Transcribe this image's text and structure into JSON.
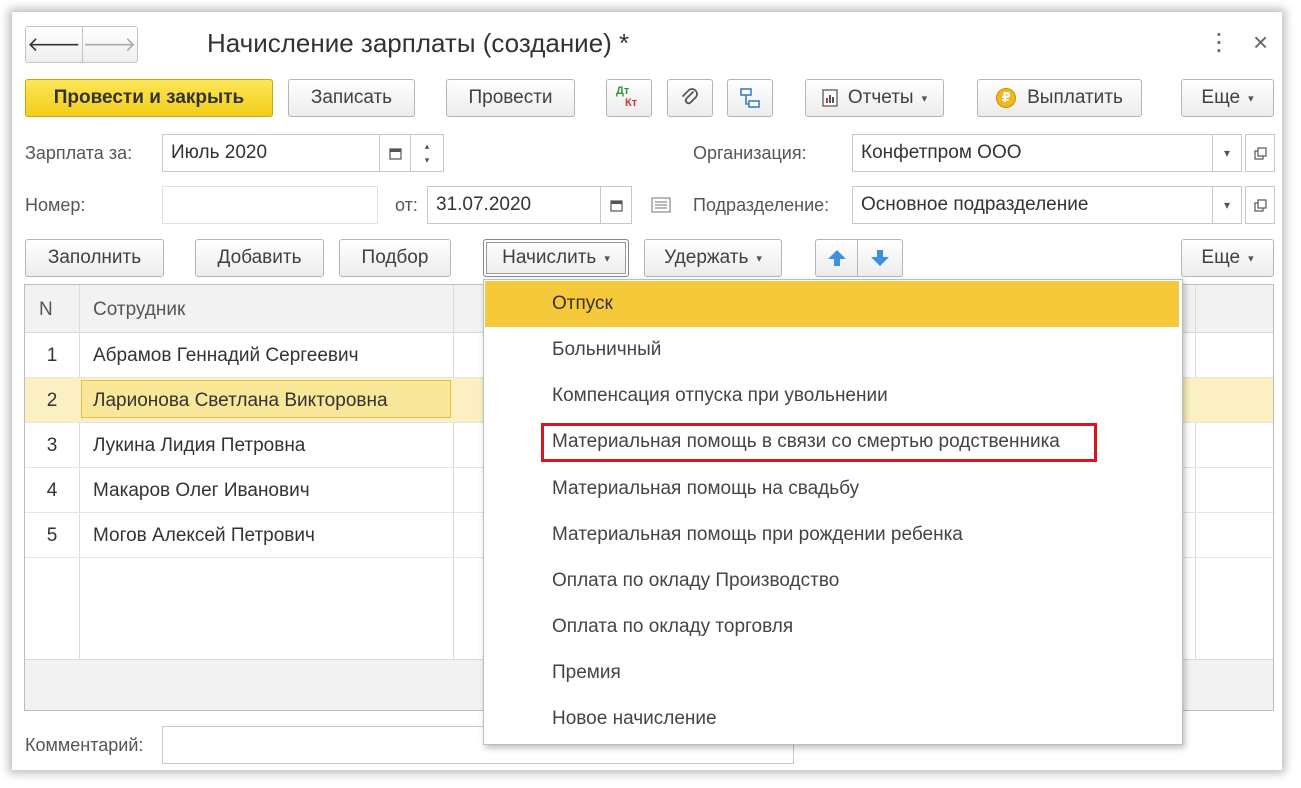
{
  "window": {
    "title": "Начисление зарплаты (создание) *",
    "more_glyph": "⋮",
    "close_glyph": "×"
  },
  "nav": {
    "back_glyph": "🡐",
    "forward_glyph": "🡒"
  },
  "toolbar": {
    "post_close": "Провести и закрыть",
    "save": "Записать",
    "post": "Провести",
    "dt_label": "Дт",
    "kt_label": "Кт",
    "reports": "Отчеты",
    "pay": "Выплатить",
    "more": "Еще"
  },
  "form": {
    "salary_for_label": "Зарплата за:",
    "salary_for_value": "Июль 2020",
    "org_label": "Организация:",
    "org_value": "Конфетпром ООО",
    "number_label": "Номер:",
    "number_value": "",
    "date_label": "от:",
    "date_value": "31.07.2020",
    "dept_label": "Подразделение:",
    "dept_value": "Основное подразделение",
    "comment_label": "Комментарий:",
    "comment_value": ""
  },
  "table_toolbar": {
    "fill": "Заполнить",
    "add": "Добавить",
    "pick": "Подбор",
    "accrue": "Начислить",
    "withhold": "Удержать",
    "more": "Еще"
  },
  "table": {
    "columns": [
      "N",
      "Сотрудник"
    ],
    "rows": [
      {
        "n": "1",
        "name": "Абрамов Геннадий Сергеевич"
      },
      {
        "n": "2",
        "name": "Ларионова Светлана Викторовна"
      },
      {
        "n": "3",
        "name": "Лукина Лидия Петровна"
      },
      {
        "n": "4",
        "name": "Макаров Олег Иванович"
      },
      {
        "n": "5",
        "name": "Могов Алексей Петрович"
      }
    ]
  },
  "accrue_menu": {
    "items": [
      "Отпуск",
      "Больничный",
      "Компенсация отпуска при увольнении",
      "Материальная помощь в связи со смертью родственника",
      "Материальная помощь на свадьбу",
      "Материальная помощь при рождении ребенка",
      "Оплата по окладу Производство",
      "Оплата по окладу торговля",
      "Премия",
      "Новое начисление"
    ]
  },
  "colors": {
    "accent_yellow": "#f6c93b",
    "highlight_red": "#d9161e",
    "arrow_blue": "#3d8fe0",
    "coin_gold": "#f0b81e"
  }
}
